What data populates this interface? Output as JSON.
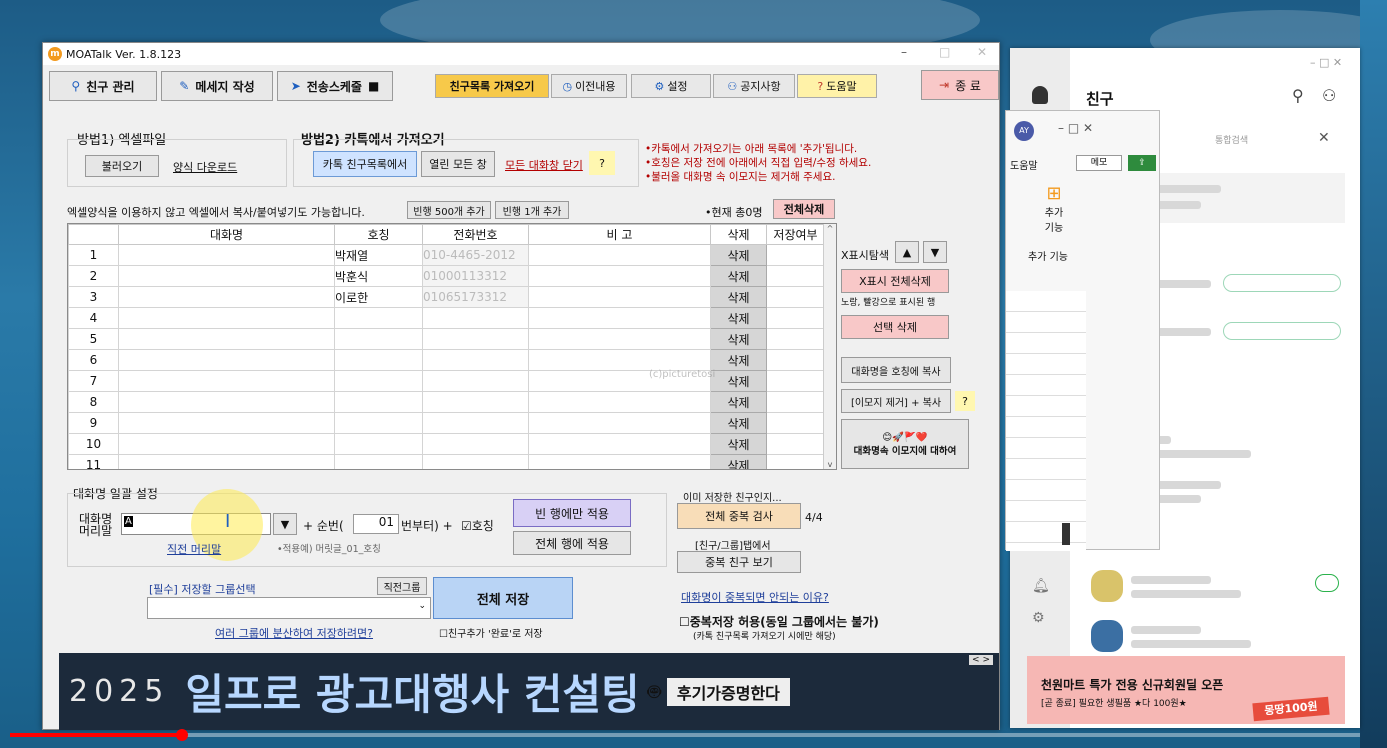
{
  "app": {
    "title": "MOATalk Ver. 1.8.123",
    "logo_letter": "m"
  },
  "toolbar": {
    "friends": "친구 관리",
    "message": "메세지 작성",
    "schedule": "전송스케줄",
    "fetch_list": "친구목록 가져오기",
    "prev": "이전내용",
    "settings": "설정",
    "notice": "공지사항",
    "help": "도움말",
    "exit": "종 료"
  },
  "method1": {
    "title": "방법1) 엑셀파일",
    "load": "불러오기",
    "download": "양식 다운로드"
  },
  "method2": {
    "title": "방법2) 카톡에서 가져오기",
    "from_list": "카톡 친구목록에서",
    "open_all": "열린 모든 창",
    "close_all": "모든 대화창 닫기",
    "q": "?"
  },
  "notes": [
    "•카톡에서 가져오기는 아래 목록에 '추가'됩니다.",
    "•호칭은 저장 전에 아래에서 직접 입력/수정 하세요.",
    "•불러올 대화명 속 이모지는 제거해 주세요."
  ],
  "grid_hint": "엑셀양식을 이용하지 않고 엑셀에서 복사/붙여넣기도 가능합니다.",
  "add500": "빈행 500개 추가",
  "add1": "빈행 1개 추가",
  "total": "•현재 총0명",
  "delete_all": "전체삭제",
  "columns": [
    "",
    "대화명",
    "호칭",
    "전화번호",
    "비 고",
    "삭제",
    "저장여부"
  ],
  "rows": [
    {
      "n": "1",
      "title": "박재열",
      "tel": "010-4465-2012"
    },
    {
      "n": "2",
      "title": "박훈식",
      "tel": "01000113312"
    },
    {
      "n": "3",
      "title": "이로한",
      "tel": "01065173312"
    },
    {
      "n": "4",
      "title": "",
      "tel": ""
    },
    {
      "n": "5",
      "title": "",
      "tel": ""
    },
    {
      "n": "6",
      "title": "",
      "tel": ""
    },
    {
      "n": "7",
      "title": "",
      "tel": ""
    },
    {
      "n": "8",
      "title": "",
      "tel": ""
    },
    {
      "n": "9",
      "title": "",
      "tel": ""
    },
    {
      "n": "10",
      "title": "",
      "tel": ""
    },
    {
      "n": "11",
      "title": "",
      "tel": ""
    }
  ],
  "del_label": "삭제",
  "side": {
    "x_search": "X표시탐색",
    "up": "▲",
    "down": "▼",
    "x_del_all": "X표시 전체삭제",
    "hl_note": "노랑, 빨강으로 표시된 행",
    "sel_del": "선택 삭제",
    "copy_name": "대화명을 호칭에 복사",
    "emoji_copy": "[이모지 제거] + 복사",
    "q": "?",
    "emoji_emojis": "😊🚀🚩❤️",
    "emoji_about": "대화명속 이모지에 대하여"
  },
  "bulk": {
    "title": "대화명 일괄 설정",
    "label1": "대화명",
    "label2": "머리말",
    "input_value": "A",
    "dropdown": "▼",
    "plus_seq": "+ 순번(",
    "seq_value": "01",
    "from": "번부터) +",
    "honor": "☑호칭",
    "recent": "직전 머리말",
    "example": "•적용예) 머릿글_01_호칭",
    "apply_empty": "빈 행에만 적용",
    "apply_all": "전체 행에 적용"
  },
  "dup": {
    "q": "이미 저장한 친구인지...",
    "check": "전체 중복 검사",
    "count": "4/4",
    "tab_note": "[친구/그룹]탭에서",
    "view": "중복 친구 보기",
    "link": "대화명이 중복되면 안되는 이유?",
    "allow": "☐중복저장 허용(동일 그룹에서는 불가)",
    "allow_note": "(카톡 친구목록 가져오기 시에만 해당)"
  },
  "save": {
    "group_label": "[필수] 저장할 그룹선택",
    "prev_group": "직전그룹",
    "save_all": "전체 저장",
    "multi": "여러 그룹에 분산하여 저장하려면?",
    "done": "☐친구추가 '완료'로 저장"
  },
  "banner": {
    "year": "2025",
    "headline": "일프로 광고대행사 컨설팅",
    "tag": "후기가증명한다",
    "nav": "< >"
  },
  "watermark": "(c)picturetosi",
  "kakao": {
    "title": "친구",
    "search_hint": "통합검색",
    "ad_title": "천원마트 특가 전용 신규회원딜 오픈",
    "ad_sub": "[곧 종료] 필요한 생필품 ★다 100원★",
    "ad_badge": "몽땅100원",
    "help": "도움말",
    "memo": "메모",
    "add": "추가",
    "add2": "기능",
    "add3": "추가 기능",
    "avatar": "AY",
    "col_f": "F"
  }
}
